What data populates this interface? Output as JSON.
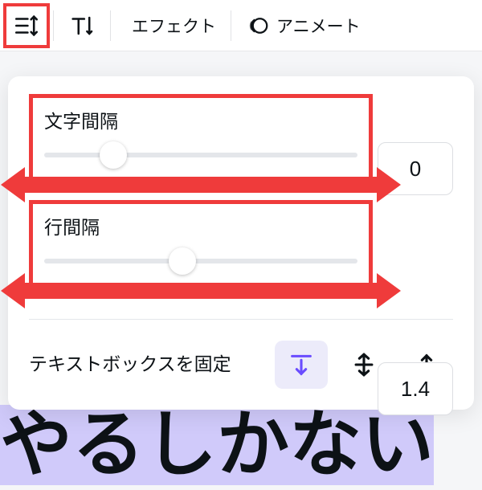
{
  "toolbar": {
    "spacing_icon": "line-spacing-icon",
    "text_icon": "text-height-icon",
    "effect_label": "エフェクト",
    "animate_label": "アニメート"
  },
  "panel": {
    "letter_spacing": {
      "label": "文字間隔",
      "value": "0",
      "thumb_pct": 22
    },
    "line_spacing": {
      "label": "行間隔",
      "value": "1.4",
      "thumb_pct": 44
    },
    "anchor_label": "テキストボックスを固定"
  },
  "background_text": "やるしかない"
}
